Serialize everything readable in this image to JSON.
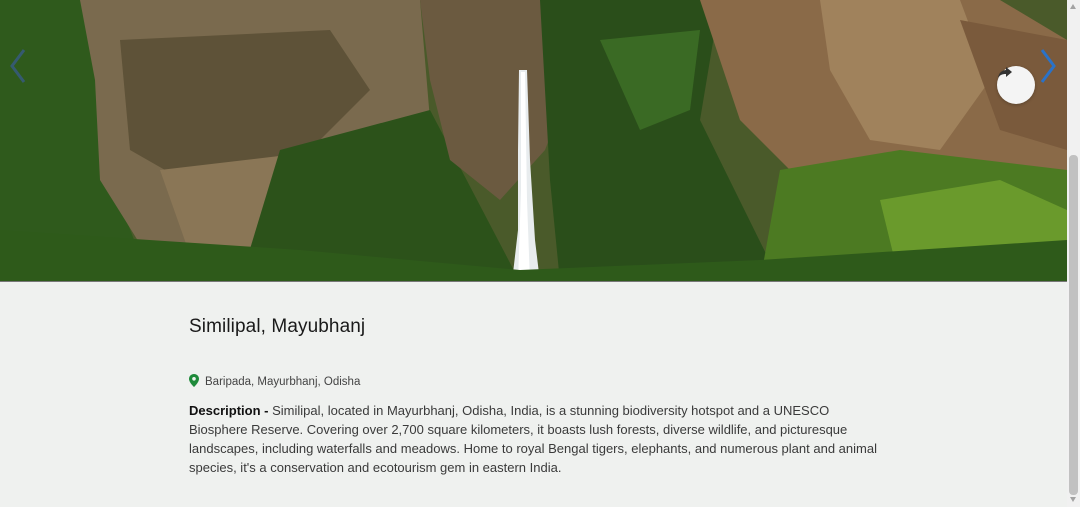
{
  "hero": {
    "image_icon": "waterfall-landscape",
    "share_icon": "share-arrow-icon",
    "prev_icon": "chevron-left-icon",
    "next_icon": "chevron-right-icon"
  },
  "place": {
    "title": "Similipal, Mayubhanj",
    "location_icon": "map-pin-icon",
    "location": "Baripada, Mayurbhanj, Odisha",
    "description_label": "Description - ",
    "description": "Similipal, located in Mayurbhanj, Odisha, India, is a stunning biodiversity hotspot and a UNESCO Biosphere Reserve. Covering over 2,700 square kilometers, it boasts lush forests, diverse wildlife, and picturesque landscapes, including waterfalls and meadows. Home to royal Bengal tigers, elephants, and numerous plant and animal species, it's a conservation and ecotourism gem in eastern India."
  },
  "colors": {
    "page_background": "#eff1ef",
    "nav_arrow": "#2a72c8",
    "pin": "#1e8a3a"
  }
}
